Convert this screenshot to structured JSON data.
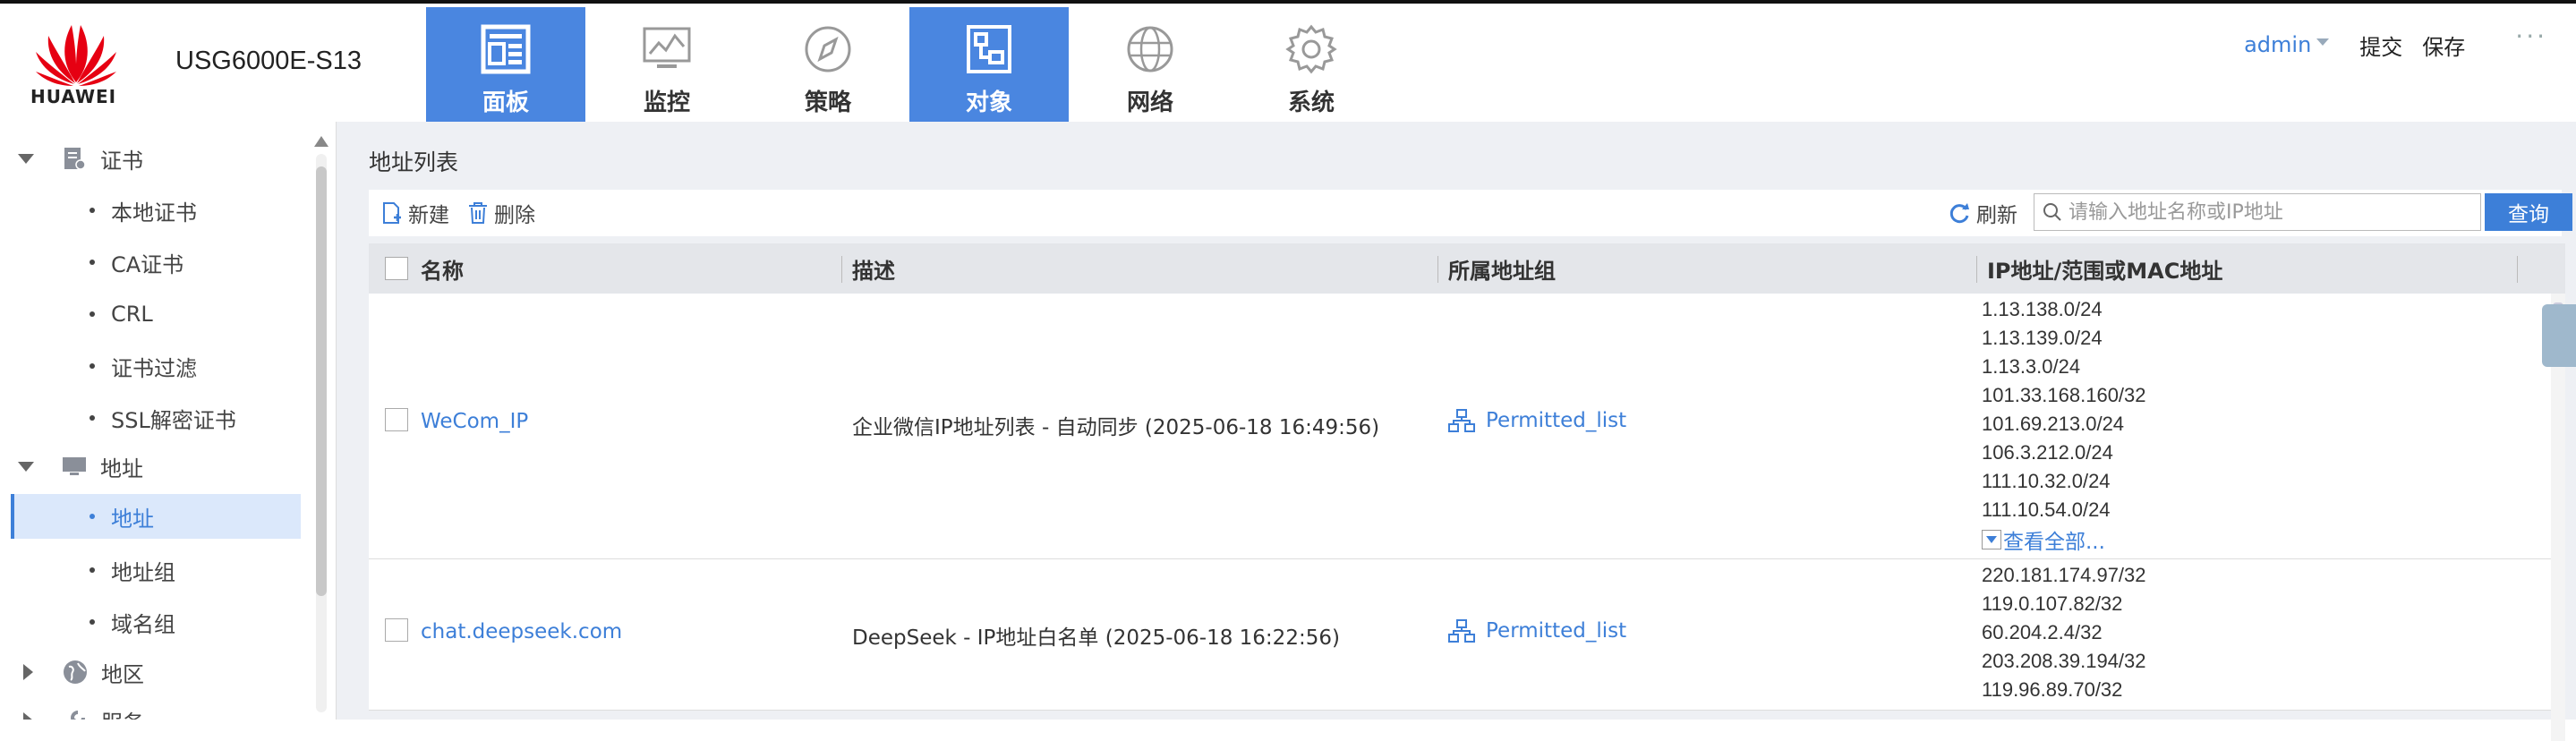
{
  "header": {
    "brand": "HUAWEI",
    "device": "USG6000E-S13",
    "nav": [
      {
        "label": "面板",
        "icon": "dashboard-icon",
        "active": true
      },
      {
        "label": "监控",
        "icon": "monitor-icon",
        "active": false
      },
      {
        "label": "策略",
        "icon": "compass-icon",
        "active": false
      },
      {
        "label": "对象",
        "icon": "object-icon",
        "active": true
      },
      {
        "label": "网络",
        "icon": "globe-icon",
        "active": false
      },
      {
        "label": "系统",
        "icon": "gear-icon",
        "active": false
      }
    ],
    "user": "admin",
    "commit": "提交",
    "save": "保存",
    "more": "···"
  },
  "sidebar": {
    "cert": {
      "label": "证书"
    },
    "cert_items": [
      "本地证书",
      "CA证书",
      "CRL",
      "证书过滤",
      "SSL解密证书"
    ],
    "addr": {
      "label": "地址"
    },
    "addr_items": [
      "地址",
      "地址组",
      "域名组"
    ],
    "region": {
      "label": "地区"
    },
    "service": {
      "label": "服务"
    },
    "selected": "地址"
  },
  "main": {
    "title": "地址列表",
    "toolbar": {
      "new": "新建",
      "delete": "删除",
      "refresh": "刷新",
      "search_placeholder": "请输入地址名称或IP地址",
      "search_btn": "查询"
    },
    "columns": [
      "名称",
      "描述",
      "所属地址组",
      "IP地址/范围或MAC地址"
    ],
    "rows": [
      {
        "name": "WeCom_IP",
        "desc": "企业微信IP地址列表 - 自动同步 (2025-06-18 16:49:56)",
        "group": "Permitted_list",
        "ips": [
          "1.13.138.0/24",
          "1.13.139.0/24",
          "1.13.3.0/24",
          "101.33.168.160/32",
          "101.69.213.0/24",
          "106.3.212.0/24",
          "111.10.32.0/24",
          "111.10.54.0/24"
        ],
        "view_all": "查看全部..."
      },
      {
        "name": "chat.deepseek.com",
        "desc": "DeepSeek - IP地址白名单 (2025-06-18 16:22:56)",
        "group": "Permitted_list",
        "ips": [
          "220.181.174.97/32",
          "119.0.107.82/32",
          "60.204.2.4/32",
          "203.208.39.194/32",
          "119.96.89.70/32"
        ]
      }
    ]
  },
  "colors": {
    "accent": "#3d7fd8",
    "nav_active": "#4a86e0",
    "brand_red": "#e60012"
  }
}
